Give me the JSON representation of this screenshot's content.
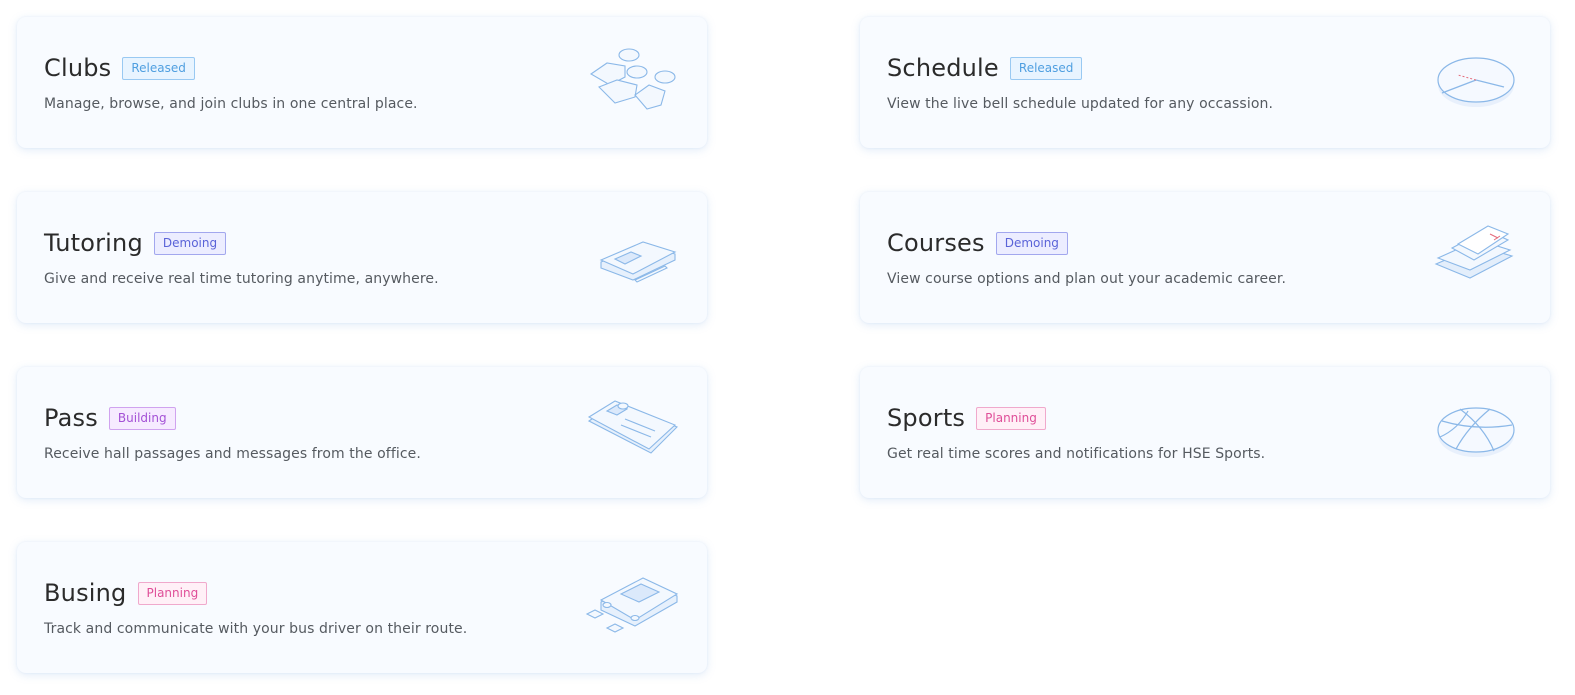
{
  "cards": {
    "clubs": {
      "title": "Clubs",
      "status": "Released",
      "description": "Manage, browse, and join clubs in one central place."
    },
    "schedule": {
      "title": "Schedule",
      "status": "Released",
      "description": "View the live bell schedule updated for any occassion."
    },
    "tutoring": {
      "title": "Tutoring",
      "status": "Demoing",
      "description": "Give and receive real time tutoring anytime, anywhere."
    },
    "courses": {
      "title": "Courses",
      "status": "Demoing",
      "description": "View course options and plan out your academic career."
    },
    "pass": {
      "title": "Pass",
      "status": "Building",
      "description": "Receive hall passages and messages from the office."
    },
    "sports": {
      "title": "Sports",
      "status": "Planning",
      "description": "Get real time scores and notifications for HSE Sports."
    },
    "busing": {
      "title": "Busing",
      "status": "Planning",
      "description": "Track and communicate with your bus driver on their route."
    }
  },
  "icons": {
    "clubs": "chat-bubbles-icon",
    "schedule": "clock-icon",
    "tutoring": "tablet-pen-icon",
    "courses": "stacked-papers-icon",
    "pass": "id-card-icon",
    "sports": "basketball-icon",
    "busing": "bus-icon"
  },
  "colors": {
    "released": "#4f9fe0",
    "demoing": "#5a63d8",
    "building": "#a451d6",
    "planning": "#df4e98",
    "illustration_stroke": "#8bb8e8"
  }
}
